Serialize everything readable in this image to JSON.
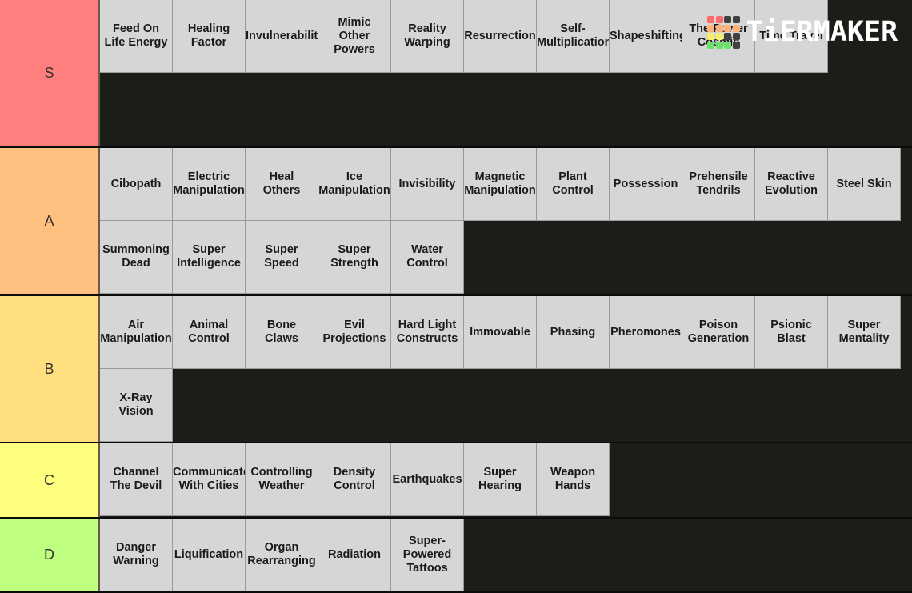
{
  "logo": {
    "text": "TiERMAKER",
    "grid_colors": [
      "#ff6b6b",
      "#ff6b6b",
      "#404040",
      "#404040",
      "#ffb27a",
      "#ffb27a",
      "#ffb27a",
      "#ffb27a",
      "#f5f06a",
      "#f5f06a",
      "#404040",
      "#404040",
      "#6ae36a",
      "#6ae36a",
      "#6ae36a",
      "#404040"
    ]
  },
  "tiers": [
    {
      "label": "S",
      "color": "#ff7f7f",
      "items": [
        "Feed On\nLife Energy",
        "Healing\nFactor",
        "Invulnerability",
        "Mimic\nOther\nPowers",
        "Reality\nWarping",
        "Resurrection",
        "Self-\nMultiplication",
        "Shapeshifting",
        "The Power\nCosmic",
        "Time Travel"
      ]
    },
    {
      "label": "A",
      "color": "#ffbf7f",
      "items": [
        "Cibopath",
        "Electric\nManipulation",
        "Heal\nOthers",
        "Ice\nManipulation",
        "Invisibility",
        "Magnetic\nManipulation",
        "Plant\nControl",
        "Possession",
        "Prehensile\nTendrils",
        "Reactive\nEvolution",
        "Steel Skin",
        "Summoning\nDead",
        "Super\nIntelligence",
        "Super\nSpeed",
        "Super\nStrength",
        "Water\nControl"
      ]
    },
    {
      "label": "B",
      "color": "#ffdf7f",
      "items": [
        "Air\nManipulation",
        "Animal\nControl",
        "Bone\nClaws",
        "Evil\nProjections",
        "Hard Light\nConstructs",
        "Immovable",
        "Phasing",
        "Pheromones",
        "Poison\nGeneration",
        "Psionic\nBlast",
        "Super\nMentality",
        "X-Ray\nVision"
      ]
    },
    {
      "label": "C",
      "color": "#ffff7f",
      "items": [
        "Channel\nThe Devil",
        "Communicate\nWith Cities",
        "Controlling\nWeather",
        "Density\nControl",
        "Earthquakes",
        "Super\nHearing",
        "Weapon\nHands"
      ]
    },
    {
      "label": "D",
      "color": "#bfff7f",
      "items": [
        "Danger\nWarning",
        "Liquification",
        "Organ\nRearranging",
        "Radiation",
        "Super-\nPowered\nTattoos"
      ]
    }
  ]
}
